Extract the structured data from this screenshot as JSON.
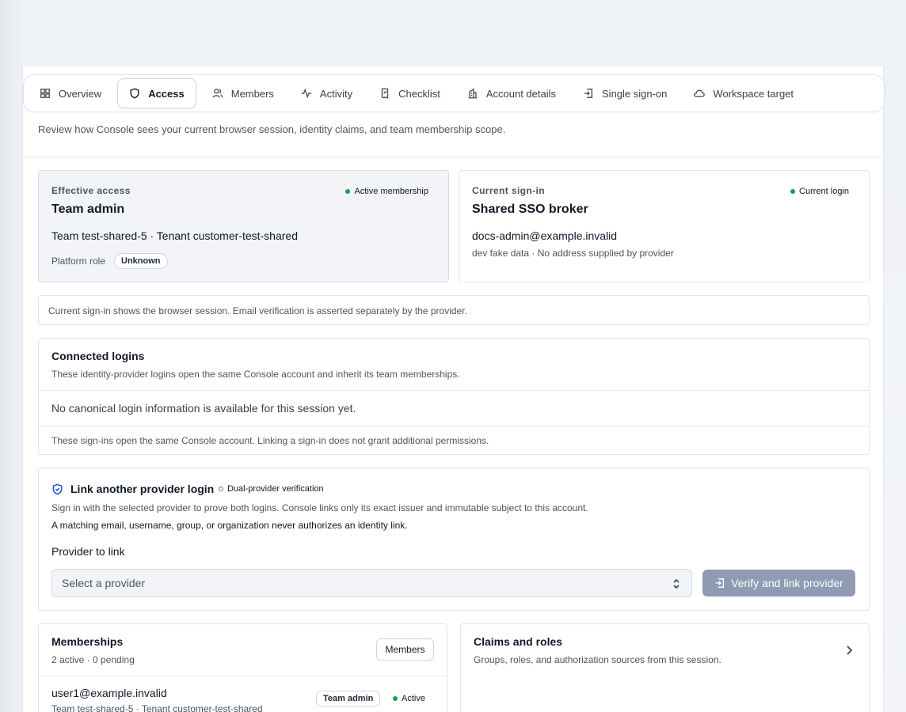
{
  "tabs": [
    {
      "label": "Overview",
      "icon": "grid-icon",
      "active": false
    },
    {
      "label": "Access",
      "icon": "shield-icon",
      "active": true
    },
    {
      "label": "Members",
      "icon": "users-icon",
      "active": false
    },
    {
      "label": "Activity",
      "icon": "activity-icon",
      "active": false
    },
    {
      "label": "Checklist",
      "icon": "checklist-icon",
      "active": false
    },
    {
      "label": "Account details",
      "icon": "building-icon",
      "active": false
    },
    {
      "label": "Single sign-on",
      "icon": "sign-in-icon",
      "active": false
    },
    {
      "label": "Workspace target",
      "icon": "cloud-icon",
      "active": false
    }
  ],
  "intro": "Review how Console sees your current browser session, identity claims, and team membership scope.",
  "effective_access": {
    "eyebrow": "Effective access",
    "status": "Active membership",
    "title": "Team admin",
    "scope": "Team test-shared-5 · Tenant customer-test-shared",
    "platform_role_label": "Platform role",
    "platform_role_value": "Unknown"
  },
  "current_signin": {
    "eyebrow": "Current sign-in",
    "status": "Current login",
    "title": "Shared SSO broker",
    "email": "docs-admin@example.invalid",
    "note": "dev fake data · No address supplied by provider"
  },
  "session_note": "Current sign-in shows the browser session. Email verification is asserted separately by the provider.",
  "connected_logins": {
    "title": "Connected logins",
    "subtitle": "These identity-provider logins open the same Console account and inherit its team memberships.",
    "empty": "No canonical login information is available for this session yet.",
    "footer": "These sign-ins open the same Console account. Linking a sign-in does not grant additional permissions."
  },
  "link_provider": {
    "title": "Link another provider login",
    "badge": "Dual-provider verification",
    "description": "Sign in with the selected provider to prove both logins. Console links only its exact issuer and immutable subject to this account.",
    "warning": "A matching email, username, group, or organization never authorizes an identity link.",
    "field_label": "Provider to link",
    "select_placeholder": "Select a provider",
    "button_label": "Verify and link provider"
  },
  "memberships": {
    "title": "Memberships",
    "counts": "2 active · 0 pending",
    "button_label": "Members",
    "rows": [
      {
        "email": "user1@example.invalid",
        "scope": "Team test-shared-5 · Tenant customer-test-shared",
        "role": "Team admin",
        "status": "Active"
      }
    ]
  },
  "claims": {
    "title": "Claims and roles",
    "subtitle": "Groups, roles, and authorization sources from this session."
  },
  "colors": {
    "active_dot": "#16a34a",
    "primary_button_disabled": "#8e9bb2",
    "muted_card": "#f3f4f8"
  }
}
